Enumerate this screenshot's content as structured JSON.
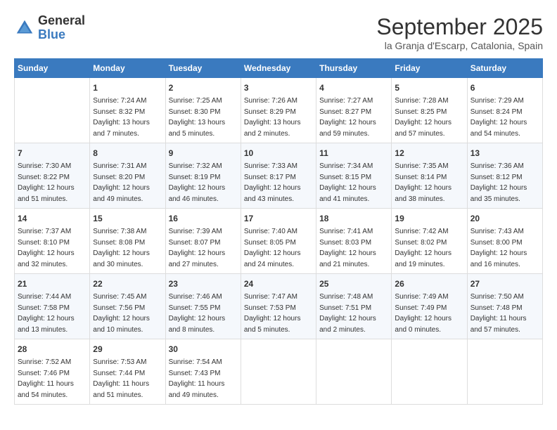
{
  "logo": {
    "line1": "General",
    "line2": "Blue"
  },
  "title": "September 2025",
  "subtitle": "la Granja d'Escarp, Catalonia, Spain",
  "days_of_week": [
    "Sunday",
    "Monday",
    "Tuesday",
    "Wednesday",
    "Thursday",
    "Friday",
    "Saturday"
  ],
  "weeks": [
    [
      {
        "day": "",
        "content": ""
      },
      {
        "day": "1",
        "content": "Sunrise: 7:24 AM\nSunset: 8:32 PM\nDaylight: 13 hours\nand 7 minutes."
      },
      {
        "day": "2",
        "content": "Sunrise: 7:25 AM\nSunset: 8:30 PM\nDaylight: 13 hours\nand 5 minutes."
      },
      {
        "day": "3",
        "content": "Sunrise: 7:26 AM\nSunset: 8:29 PM\nDaylight: 13 hours\nand 2 minutes."
      },
      {
        "day": "4",
        "content": "Sunrise: 7:27 AM\nSunset: 8:27 PM\nDaylight: 12 hours\nand 59 minutes."
      },
      {
        "day": "5",
        "content": "Sunrise: 7:28 AM\nSunset: 8:25 PM\nDaylight: 12 hours\nand 57 minutes."
      },
      {
        "day": "6",
        "content": "Sunrise: 7:29 AM\nSunset: 8:24 PM\nDaylight: 12 hours\nand 54 minutes."
      }
    ],
    [
      {
        "day": "7",
        "content": "Sunrise: 7:30 AM\nSunset: 8:22 PM\nDaylight: 12 hours\nand 51 minutes."
      },
      {
        "day": "8",
        "content": "Sunrise: 7:31 AM\nSunset: 8:20 PM\nDaylight: 12 hours\nand 49 minutes."
      },
      {
        "day": "9",
        "content": "Sunrise: 7:32 AM\nSunset: 8:19 PM\nDaylight: 12 hours\nand 46 minutes."
      },
      {
        "day": "10",
        "content": "Sunrise: 7:33 AM\nSunset: 8:17 PM\nDaylight: 12 hours\nand 43 minutes."
      },
      {
        "day": "11",
        "content": "Sunrise: 7:34 AM\nSunset: 8:15 PM\nDaylight: 12 hours\nand 41 minutes."
      },
      {
        "day": "12",
        "content": "Sunrise: 7:35 AM\nSunset: 8:14 PM\nDaylight: 12 hours\nand 38 minutes."
      },
      {
        "day": "13",
        "content": "Sunrise: 7:36 AM\nSunset: 8:12 PM\nDaylight: 12 hours\nand 35 minutes."
      }
    ],
    [
      {
        "day": "14",
        "content": "Sunrise: 7:37 AM\nSunset: 8:10 PM\nDaylight: 12 hours\nand 32 minutes."
      },
      {
        "day": "15",
        "content": "Sunrise: 7:38 AM\nSunset: 8:08 PM\nDaylight: 12 hours\nand 30 minutes."
      },
      {
        "day": "16",
        "content": "Sunrise: 7:39 AM\nSunset: 8:07 PM\nDaylight: 12 hours\nand 27 minutes."
      },
      {
        "day": "17",
        "content": "Sunrise: 7:40 AM\nSunset: 8:05 PM\nDaylight: 12 hours\nand 24 minutes."
      },
      {
        "day": "18",
        "content": "Sunrise: 7:41 AM\nSunset: 8:03 PM\nDaylight: 12 hours\nand 21 minutes."
      },
      {
        "day": "19",
        "content": "Sunrise: 7:42 AM\nSunset: 8:02 PM\nDaylight: 12 hours\nand 19 minutes."
      },
      {
        "day": "20",
        "content": "Sunrise: 7:43 AM\nSunset: 8:00 PM\nDaylight: 12 hours\nand 16 minutes."
      }
    ],
    [
      {
        "day": "21",
        "content": "Sunrise: 7:44 AM\nSunset: 7:58 PM\nDaylight: 12 hours\nand 13 minutes."
      },
      {
        "day": "22",
        "content": "Sunrise: 7:45 AM\nSunset: 7:56 PM\nDaylight: 12 hours\nand 10 minutes."
      },
      {
        "day": "23",
        "content": "Sunrise: 7:46 AM\nSunset: 7:55 PM\nDaylight: 12 hours\nand 8 minutes."
      },
      {
        "day": "24",
        "content": "Sunrise: 7:47 AM\nSunset: 7:53 PM\nDaylight: 12 hours\nand 5 minutes."
      },
      {
        "day": "25",
        "content": "Sunrise: 7:48 AM\nSunset: 7:51 PM\nDaylight: 12 hours\nand 2 minutes."
      },
      {
        "day": "26",
        "content": "Sunrise: 7:49 AM\nSunset: 7:49 PM\nDaylight: 12 hours\nand 0 minutes."
      },
      {
        "day": "27",
        "content": "Sunrise: 7:50 AM\nSunset: 7:48 PM\nDaylight: 11 hours\nand 57 minutes."
      }
    ],
    [
      {
        "day": "28",
        "content": "Sunrise: 7:52 AM\nSunset: 7:46 PM\nDaylight: 11 hours\nand 54 minutes."
      },
      {
        "day": "29",
        "content": "Sunrise: 7:53 AM\nSunset: 7:44 PM\nDaylight: 11 hours\nand 51 minutes."
      },
      {
        "day": "30",
        "content": "Sunrise: 7:54 AM\nSunset: 7:43 PM\nDaylight: 11 hours\nand 49 minutes."
      },
      {
        "day": "",
        "content": ""
      },
      {
        "day": "",
        "content": ""
      },
      {
        "day": "",
        "content": ""
      },
      {
        "day": "",
        "content": ""
      }
    ]
  ]
}
